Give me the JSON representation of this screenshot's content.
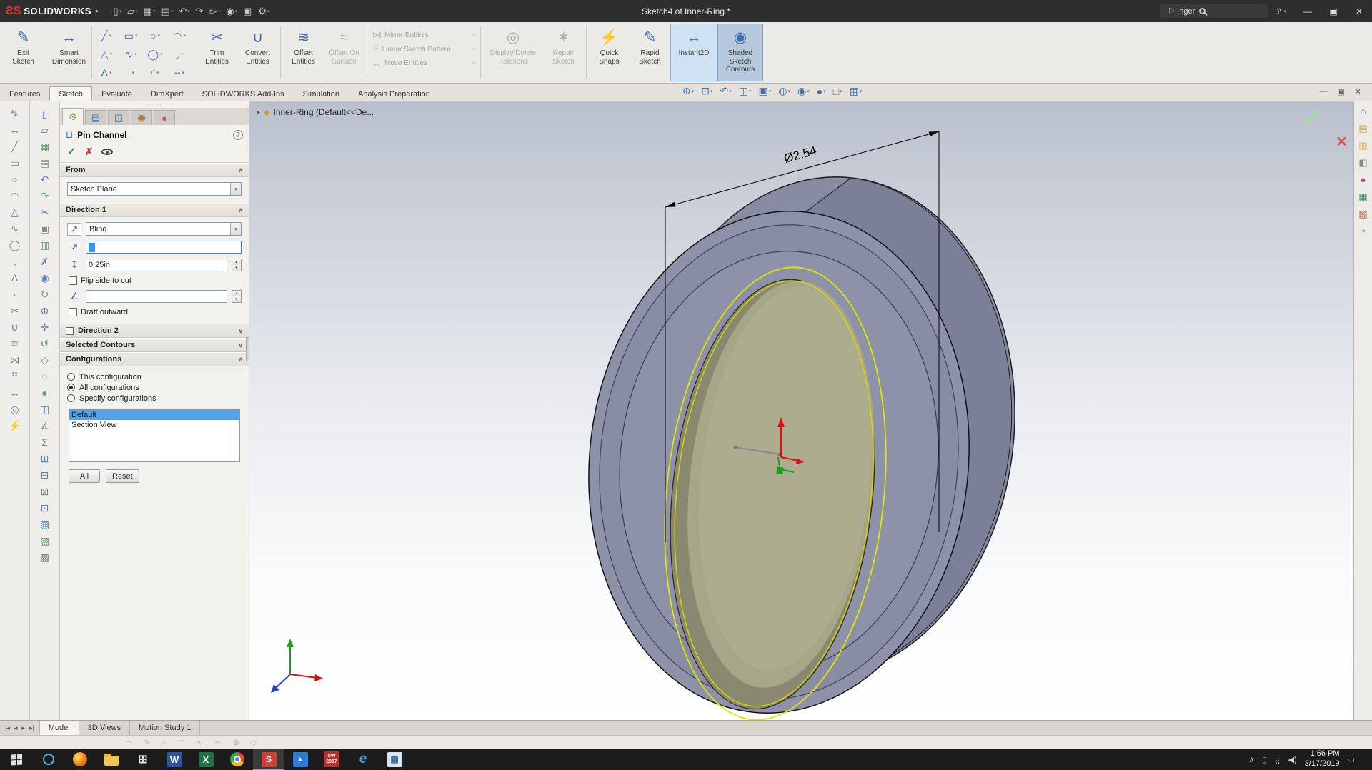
{
  "icons": {
    "caret": "▾",
    "spin_up": "▴",
    "spin_down": "▾",
    "chevron_up": "∧",
    "chevron_down": "∨",
    "breadcrumb_arrow": "▸",
    "logo_arrow": "▸",
    "grip": "·····",
    "flag": "⚐"
  },
  "titlebar": {
    "logo_text": "SOLIDWORKS",
    "title": "Sketch4 of Inner-Ring *",
    "search_text": "nger",
    "help": "?",
    "quick_access": [
      {
        "name": "new-document-button",
        "glyph": "▯",
        "caret": "▾"
      },
      {
        "name": "open-document-button",
        "glyph": "▱",
        "caret": "▾"
      },
      {
        "name": "save-button",
        "glyph": "▦",
        "caret": "▾"
      },
      {
        "name": "print-button",
        "glyph": "▤",
        "caret": "▾"
      },
      {
        "name": "undo-button",
        "glyph": "↶",
        "caret": "▾"
      },
      {
        "name": "redo-button",
        "glyph": "↷",
        "caret": ""
      },
      {
        "name": "select-button",
        "glyph": "▻",
        "caret": "▾"
      },
      {
        "name": "rebuild-button",
        "glyph": "◉",
        "caret": "▾"
      },
      {
        "name": "file-properties-button",
        "glyph": "▣",
        "caret": ""
      },
      {
        "name": "options-button",
        "glyph": "⚙",
        "caret": "▾"
      }
    ],
    "window_buttons": [
      {
        "name": "minimize-button",
        "glyph": "—"
      },
      {
        "name": "restore-button",
        "glyph": "▣"
      },
      {
        "name": "close-button",
        "glyph": "✕"
      }
    ]
  },
  "command_tabs": [
    {
      "label": "Features"
    },
    {
      "label": "Sketch",
      "cls": "active"
    },
    {
      "label": "Evaluate"
    },
    {
      "label": "DimXpert"
    },
    {
      "label": "SOLIDWORKS Add-Ins"
    },
    {
      "label": "Simulation"
    },
    {
      "label": "Analysis Preparation"
    }
  ],
  "ribbon": {
    "exit_sketch": {
      "label": "Exit\nSketch",
      "glyph": "✎"
    },
    "smart_dimension": {
      "label": "Smart\nDimension",
      "glyph": "↔"
    },
    "entity_grid": [
      {
        "name": "line-tool",
        "glyph": "╱"
      },
      {
        "name": "corner-rectangle-tool",
        "glyph": "▭"
      },
      {
        "name": "circle-tool",
        "glyph": "○"
      },
      {
        "name": "centerpoint-arc-tool",
        "glyph": "◠"
      },
      {
        "name": "polygon-tool",
        "glyph": "△"
      },
      {
        "name": "spline-tool",
        "glyph": "∿"
      },
      {
        "name": "ellipse-tool",
        "glyph": "◯"
      },
      {
        "name": "sketch-fillet-tool",
        "glyph": "◞"
      },
      {
        "name": "text-tool",
        "glyph": "A"
      },
      {
        "name": "point-tool",
        "glyph": "·"
      },
      {
        "name": "three-point-arc-tool",
        "glyph": "◜"
      },
      {
        "name": "construction-geometry-tool",
        "glyph": "╌"
      }
    ],
    "trim_entities": {
      "label": "Trim\nEntities",
      "glyph": "✂"
    },
    "convert_entities": {
      "label": "Convert\nEntities",
      "glyph": "∪"
    },
    "offset_entities": {
      "label": "Offset\nEntities",
      "glyph": "≋"
    },
    "offset_on_surface": {
      "label": "Offset On\nSurface",
      "glyph": "≈"
    },
    "pattern_rows": [
      {
        "name": "mirror-entities",
        "label": "Mirror Entities",
        "glyph": "⋈"
      },
      {
        "name": "linear-sketch-pattern",
        "label": "Linear Sketch Pattern",
        "glyph": "⠛"
      },
      {
        "name": "move-entities",
        "label": "Move Entities",
        "glyph": "↔"
      }
    ],
    "display_delete": {
      "label": "Display/Delete\nRelations",
      "glyph": "◎"
    },
    "repair_sketch": {
      "label": "Repair\nSketch",
      "glyph": "✶"
    },
    "quick_snaps": {
      "label": "Quick\nSnaps",
      "glyph": "⚡"
    },
    "rapid_sketch": {
      "label": "Rapid\nSketch",
      "glyph": "✎"
    },
    "instant2d": {
      "label": "Instant2D",
      "glyph": "↔"
    },
    "shaded_contours": {
      "label": "Shaded\nSketch\nContours",
      "glyph": "◉"
    }
  },
  "view_toolbar": [
    {
      "name": "zoom-fit-icon",
      "glyph": "⊕"
    },
    {
      "name": "zoom-area-icon",
      "glyph": "⊡"
    },
    {
      "name": "previous-view-icon",
      "glyph": "↶"
    },
    {
      "name": "section-view-icon",
      "glyph": "◫"
    },
    {
      "name": "view-orientation-icon",
      "glyph": "▣"
    },
    {
      "name": "display-style-icon",
      "glyph": "◍"
    },
    {
      "name": "hide-show-items-icon",
      "glyph": "◉"
    },
    {
      "name": "edit-appearance-icon",
      "glyph": "●"
    },
    {
      "name": "apply-scene-icon",
      "glyph": "□"
    },
    {
      "name": "view-settings-icon",
      "glyph": "▦"
    }
  ],
  "doc_window_buttons": [
    {
      "name": "doc-minimize-button",
      "glyph": "—"
    },
    {
      "name": "doc-restore-button",
      "glyph": "▣"
    },
    {
      "name": "doc-close-button",
      "glyph": "✕"
    }
  ],
  "left_toolbar_outer": [
    {
      "name": "sketch-icon",
      "glyph": "✎"
    },
    {
      "name": "smart-dimension-icon",
      "glyph": "↔"
    },
    {
      "name": "line-icon",
      "glyph": "╱"
    },
    {
      "name": "rectangle-icon",
      "glyph": "▭"
    },
    {
      "name": "circle-icon",
      "glyph": "○"
    },
    {
      "name": "arc-icon",
      "glyph": "◠"
    },
    {
      "name": "polygon-icon",
      "glyph": "△"
    },
    {
      "name": "spline-icon",
      "glyph": "∿"
    },
    {
      "name": "ellipse-icon",
      "glyph": "◯"
    },
    {
      "name": "fillet-icon",
      "glyph": "◞"
    },
    {
      "name": "text-icon",
      "glyph": "A"
    },
    {
      "name": "point-icon",
      "glyph": "·"
    },
    {
      "name": "trim-icon",
      "glyph": "✂"
    },
    {
      "name": "convert-icon",
      "glyph": "∪"
    },
    {
      "name": "offset-icon",
      "glyph": "≋"
    },
    {
      "name": "mirror-icon",
      "glyph": "⋈"
    },
    {
      "name": "pattern-icon",
      "glyph": "⠛"
    },
    {
      "name": "move-icon",
      "glyph": "↔"
    },
    {
      "name": "relations-icon",
      "glyph": "◎"
    },
    {
      "name": "snaps-icon",
      "glyph": "⚡"
    }
  ],
  "left_toolbar_inner": [
    {
      "name": "new-icon",
      "glyph": "▯"
    },
    {
      "name": "open-icon",
      "glyph": "▱"
    },
    {
      "name": "save-icon",
      "glyph": "▦"
    },
    {
      "name": "print-icon",
      "glyph": "▤"
    },
    {
      "name": "undo-icon",
      "glyph": "↶"
    },
    {
      "name": "redo-icon",
      "glyph": "↷"
    },
    {
      "name": "cut-icon",
      "glyph": "✂"
    },
    {
      "name": "copy-icon",
      "glyph": "▣"
    },
    {
      "name": "paste-icon",
      "glyph": "▥"
    },
    {
      "name": "delete-icon",
      "glyph": "✗"
    },
    {
      "name": "rebuild-icon",
      "glyph": "◉"
    },
    {
      "name": "redraw-icon",
      "glyph": "↻"
    },
    {
      "name": "zoom-icon",
      "glyph": "⊕"
    },
    {
      "name": "pan-icon",
      "glyph": "✛"
    },
    {
      "name": "rotate-view-icon",
      "glyph": "↺"
    },
    {
      "name": "wireframe-icon",
      "glyph": "◇"
    },
    {
      "name": "hidden-lines-icon",
      "glyph": "◌"
    },
    {
      "name": "shaded-icon",
      "glyph": "●"
    },
    {
      "name": "section-icon",
      "glyph": "◫"
    },
    {
      "name": "measure-icon",
      "glyph": "∡"
    },
    {
      "name": "mass-properties-icon",
      "glyph": "Σ"
    },
    {
      "name": "copy-entities-icon",
      "glyph": "⊞"
    },
    {
      "name": "paste-entities-icon",
      "glyph": "⊟"
    },
    {
      "name": "block-icon",
      "glyph": "⊠"
    },
    {
      "name": "insert-block-icon",
      "glyph": "⊡"
    },
    {
      "name": "make-block-icon",
      "glyph": "▧"
    },
    {
      "name": "edit-block-icon",
      "glyph": "▨"
    },
    {
      "name": "explode-block-icon",
      "glyph": "▩"
    }
  ],
  "property_panel": {
    "tabs": [
      {
        "name": "propertymanager-tab",
        "glyph": "⚙",
        "color": "#7a9c3c",
        "cls": "active"
      },
      {
        "name": "configurationmanager-tab",
        "glyph": "▤",
        "color": "#3a6fb0"
      },
      {
        "name": "dimxpertmanager-tab",
        "glyph": "◫",
        "color": "#3a6fb0"
      },
      {
        "name": "displaymanager-tab",
        "glyph": "◉",
        "color": "#b07a2c"
      },
      {
        "name": "appearances-tab",
        "glyph": "●",
        "color": "#c04a9e"
      }
    ],
    "title": "Pin Channel",
    "from": {
      "header": "From",
      "value": "Sketch Plane"
    },
    "direction1": {
      "header": "Direction 1",
      "end_condition": "Blind",
      "depth_value": "0.25in",
      "flip_label": "Flip side to cut",
      "draft_label": "Draft outward"
    },
    "direction2_header": "Direction 2",
    "contours_header": "Selected Contours",
    "config": {
      "header": "Configurations",
      "options": [
        {
          "label": "This configuration"
        },
        {
          "label": "All configurations",
          "cls": "sel"
        },
        {
          "label": "Specify configurations"
        }
      ],
      "list": [
        {
          "label": "Default",
          "cls": "sel"
        },
        {
          "label": "Section View"
        }
      ],
      "all_button": "All",
      "reset_button": "Reset"
    }
  },
  "viewport": {
    "breadcrumb": "Inner-Ring (Default<<De...",
    "dimension_label": "Ø2.54"
  },
  "task_pane": [
    {
      "name": "home-icon",
      "glyph": "⌂",
      "color": "#4a6fa5"
    },
    {
      "name": "design-library-icon",
      "glyph": "▤",
      "color": "#c8973c"
    },
    {
      "name": "file-explorer-icon",
      "glyph": "▥",
      "color": "#d8b23c"
    },
    {
      "name": "view-palette-icon",
      "glyph": "◧",
      "color": "#888888"
    },
    {
      "name": "appearances-icon",
      "glyph": "●",
      "color": "#b04a9e"
    },
    {
      "name": "scenes-icon",
      "glyph": "▦",
      "color": "#3f8f6f"
    },
    {
      "name": "custom-properties-icon",
      "glyph": "▧",
      "color": "#b05a3c"
    },
    {
      "name": "forum-icon",
      "glyph": "◔",
      "color": "#5a7fae"
    }
  ],
  "bottom_tabs": {
    "nav": [
      {
        "name": "first-tab-button",
        "glyph": "|◂"
      },
      {
        "name": "prev-tab-button",
        "glyph": "◂"
      },
      {
        "name": "next-tab-button",
        "glyph": "▸"
      },
      {
        "name": "last-tab-button",
        "glyph": "▸|"
      }
    ],
    "tabs": [
      {
        "label": "Model",
        "cls": "active"
      },
      {
        "label": "3D Views"
      },
      {
        "label": "Motion Study 1"
      }
    ]
  },
  "status_icons": [
    {
      "name": "status-icon-rectangle",
      "glyph": "▭"
    },
    {
      "name": "status-icon-pencil",
      "glyph": "✎"
    },
    {
      "name": "status-icon-circle",
      "glyph": "○"
    },
    {
      "name": "status-icon-arc",
      "glyph": "◠"
    },
    {
      "name": "status-icon-spline",
      "glyph": "∿"
    },
    {
      "name": "status-icon-trim",
      "glyph": "✂"
    },
    {
      "name": "status-icon-zoom",
      "glyph": "⊕"
    },
    {
      "name": "status-icon-diamond",
      "glyph": "◇"
    }
  ],
  "taskbar": {
    "apps": [
      {
        "name": "taskbar-cortana",
        "cls": "tb-cortana",
        "glyph": ""
      },
      {
        "name": "taskbar-firefox",
        "cls": "tb-firefox",
        "glyph": ""
      },
      {
        "name": "taskbar-file-explorer",
        "cls": "tb-folder",
        "glyph": ""
      },
      {
        "name": "taskbar-app-grid",
        "cls": "tb-grid",
        "glyph": "⊞"
      },
      {
        "name": "taskbar-word",
        "cls": "tb-word",
        "glyph": "W"
      },
      {
        "name": "taskbar-excel",
        "cls": "tb-excel",
        "glyph": "X"
      },
      {
        "name": "taskbar-chrome",
        "cls": "tb-chrome",
        "glyph": ""
      },
      {
        "name": "taskbar-solidworks",
        "cls": "tb-sw active",
        "glyph": "S"
      },
      {
        "name": "taskbar-photos",
        "cls": "tb-photos",
        "glyph": "▲"
      },
      {
        "name": "taskbar-solidworks-2017",
        "cls": "tb-sw2017",
        "glyph": "SW\n2017"
      },
      {
        "name": "taskbar-edge",
        "cls": "tb-edge",
        "glyph": "e"
      },
      {
        "name": "taskbar-calculator",
        "cls": "tb-calc",
        "glyph": "▦"
      }
    ],
    "tray": [
      {
        "name": "hidden-icons-chevron",
        "glyph": "∧"
      },
      {
        "name": "battery-icon",
        "glyph": "▯"
      },
      {
        "name": "network-icon",
        "glyph": "⣴"
      },
      {
        "name": "volume-icon",
        "glyph": "◀)"
      }
    ],
    "time": "1:56 PM",
    "date": "3/17/2019"
  }
}
